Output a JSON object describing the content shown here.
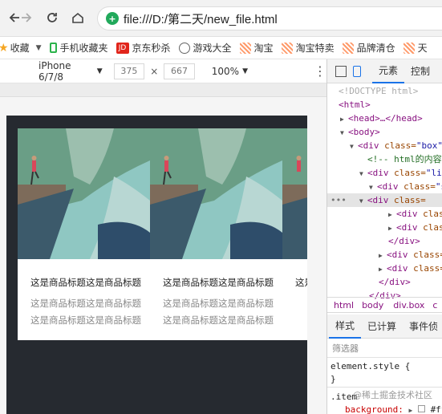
{
  "browser": {
    "address": "file:///D:/第二天/new_file.html",
    "back_icon": "arrow-left-icon",
    "forward_icon": "arrow-right-icon",
    "reload_icon": "reload-icon",
    "home_icon": "home-icon"
  },
  "bookmarks": [
    {
      "label": "收藏",
      "icon": "star-icon",
      "color": "#f5a623"
    },
    {
      "label": "手机收藏夹",
      "icon": "phone-icon",
      "color": "#2bb34b"
    },
    {
      "label": "京东秒杀",
      "icon": "jd-icon",
      "color": "#e1251b",
      "icon_text": "JD"
    },
    {
      "label": "游戏大全",
      "icon": "globe-icon",
      "color": "#666666"
    },
    {
      "label": "淘宝",
      "icon": "taobao-icon",
      "color": "#ff7a45"
    },
    {
      "label": "淘宝特卖",
      "icon": "taobao-icon",
      "color": "#ff7a45"
    },
    {
      "label": "品牌清仓",
      "icon": "taobao-icon",
      "color": "#ff7a45"
    },
    {
      "label": "天",
      "icon": "taobao-icon",
      "color": "#ff7a45"
    }
  ],
  "device_toolbar": {
    "device": "iPhone 6/7/8",
    "width": "375",
    "times": "×",
    "height": "667",
    "zoom": "100%"
  },
  "cards": [
    {
      "title": "这是商品标题这是商品标题",
      "desc": "这是商品标题这是商品标题这是商品标题这是商品标题"
    },
    {
      "title": "这是商品标题这是商品标题",
      "desc": "这是商品标题这是商品标题这是商品标题这是商品标题"
    },
    {
      "title": "这是",
      "desc": ""
    }
  ],
  "devtools": {
    "tabs": [
      "元素",
      "控制"
    ],
    "dom": {
      "doctype": "<!DOCTYPE html>",
      "html_open": "<html>",
      "head": "<head>…</head>",
      "body_open": "<body>",
      "box_prefix": "<div ",
      "box_attr": "class=",
      "box_val": "\"box\"",
      "comment": "<!-- html的内容",
      "li_prefix": "<div ",
      "li_attr": "class=",
      "li_val": "\"li",
      "s_prefix": "<div ",
      "s_attr": "class=",
      "s_val": "\"s",
      "sel_prefix": "<div ",
      "sel_attr": "class=",
      "child1_prefix": "<div ",
      "child1_attr": "clas",
      "child2_prefix": "<div ",
      "child2_attr": "clas",
      "div_close": "</div>",
      "sib1_prefix": "<div ",
      "sib1_attr": "class=",
      "sib2_prefix": "<div ",
      "sib2_attr": "class=",
      "div_close2": "</div>",
      "div_close3": "</div>"
    },
    "breadcrumbs": [
      "html",
      "body",
      "div.box",
      "c"
    ],
    "subtabs": [
      "样式",
      "已计算",
      "事件侦"
    ],
    "filter_placeholder": "筛选器",
    "styles": {
      "element_style": "element.style {",
      "close_brace": "}",
      "selector": ".item",
      "property": "background:",
      "value": "#ff"
    }
  },
  "watermark": "@稀土掘金技术社区"
}
